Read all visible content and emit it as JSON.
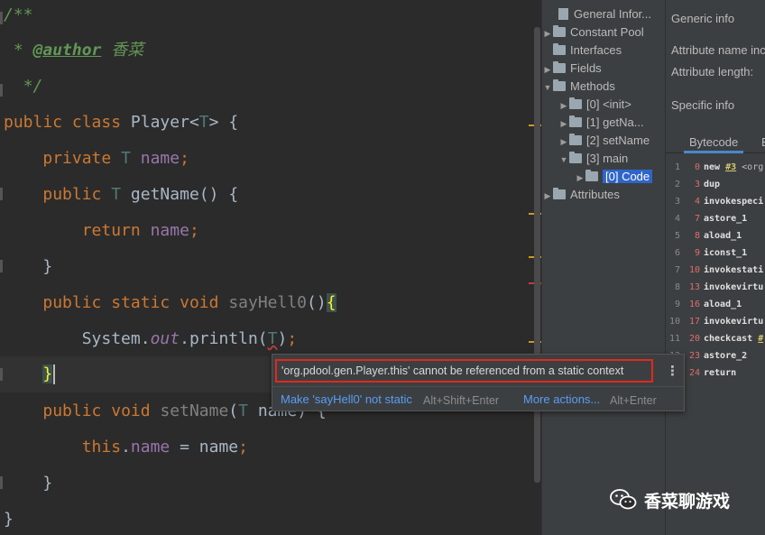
{
  "editor": {
    "comment": {
      "open": "/**",
      "star": "* ",
      "tag": "@author",
      "author": "香菜",
      "close": "*/"
    },
    "class_decl": {
      "kw_public": "public",
      "kw_class": "class",
      "name": "Player",
      "type_open": "<",
      "type_param": "T",
      "type_close": ">",
      "brace": "{"
    },
    "field": {
      "kw": "private",
      "type": "T",
      "name": "name",
      "semi": ";"
    },
    "getter": {
      "kw": "public",
      "type": "T",
      "name": "getName",
      "parens": "()",
      "brace": "{"
    },
    "getter_body": {
      "kw": "return",
      "name": "name",
      "semi": ";"
    },
    "close_brace": "}",
    "main_method": {
      "kw_public": "public",
      "kw_static": "static",
      "kw_void": "void",
      "name": "sayHell0",
      "parens": "()",
      "brace": "{"
    },
    "println": {
      "cls": "System",
      "dot1": ".",
      "out": "out",
      "dot2": ".",
      "method": "println",
      "paren_open": "(",
      "arg": "T",
      "paren_close": ")",
      "semi": ";"
    },
    "setter": {
      "kw_public": "public",
      "kw_void": "void",
      "name": "setName",
      "paren_open": "(",
      "type": "T",
      "param": "name",
      "paren_close": ")",
      "brace": "{"
    },
    "setter_body": {
      "kw_this": "this",
      "dot": ".",
      "field": "name",
      "op": " = ",
      "value": "name",
      "semi": ";"
    }
  },
  "popup": {
    "message": "'org.pdool.gen.Player.this' cannot be referenced from a static context",
    "fix_label": "Make 'sayHell0' not static",
    "fix_shortcut": "Alt+Shift+Enter",
    "more_label": "More actions...",
    "more_shortcut": "Alt+Enter",
    "menu_glyph": "⋮"
  },
  "tree": {
    "items": [
      {
        "label": "General Infor..."
      },
      {
        "label": "Constant Pool"
      },
      {
        "label": "Interfaces"
      },
      {
        "label": "Fields"
      },
      {
        "label": "Methods"
      },
      {
        "label": "[0] <init>"
      },
      {
        "label": "[1] getNa..."
      },
      {
        "label": "[2] setName"
      },
      {
        "label": "[3] main"
      },
      {
        "label": "[0] Code"
      },
      {
        "label": "Attributes"
      }
    ]
  },
  "info": {
    "generic_info": "Generic info",
    "attr_name": "Attribute name inc",
    "attr_length": "Attribute length:",
    "specific_info": "Specific info",
    "tab_bytecode": "Bytecode",
    "tab_other": "E"
  },
  "bytecode": [
    {
      "line": "1",
      "offset": "0",
      "text": "new ",
      "ref": "#3",
      "rest": " <org"
    },
    {
      "line": "2",
      "offset": "3",
      "text": "dup"
    },
    {
      "line": "3",
      "offset": "4",
      "text": "invokespeci"
    },
    {
      "line": "4",
      "offset": "7",
      "text": "astore_1"
    },
    {
      "line": "5",
      "offset": "8",
      "text": "aload_1"
    },
    {
      "line": "6",
      "offset": "9",
      "text": "iconst_1"
    },
    {
      "line": "7",
      "offset": "10",
      "text": "invokestati"
    },
    {
      "line": "8",
      "offset": "13",
      "text": "invokevirtu"
    },
    {
      "line": "9",
      "offset": "16",
      "text": "aload_1"
    },
    {
      "line": "10",
      "offset": "17",
      "text": "invokevirtu"
    },
    {
      "line": "11",
      "offset": "20",
      "text": "checkcast ",
      "ref": "#"
    },
    {
      "line": "12",
      "offset": "23",
      "text": "astore_2"
    },
    {
      "line": "13",
      "offset": "24",
      "text": "return"
    }
  ],
  "watermark": {
    "text": "香菜聊游戏",
    "icon": "wechat-icon"
  },
  "colors": {
    "error_border": "#e0291c",
    "link": "#589df6",
    "selection": "#2f65ca"
  }
}
